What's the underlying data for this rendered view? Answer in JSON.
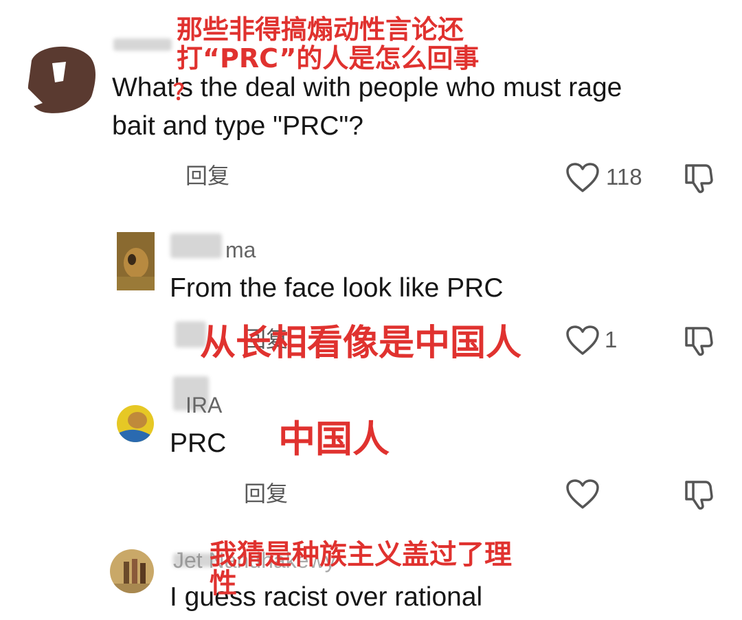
{
  "comments": [
    {
      "username": "",
      "text_lines": [
        "What's the deal with people who must rage",
        "bait and type \"PRC\"?"
      ],
      "reply_label": "回复",
      "likes": "118",
      "annotation_lines": [
        "那些非得搞煽动性言论还",
        "打“PRC”的人是怎么回事"
      ],
      "annotation_mark": "？"
    },
    {
      "username": "ma",
      "text": "From the face look like PRC",
      "reply_label": "回复",
      "likes": "1",
      "annotation": "从长相看像是中国人"
    },
    {
      "username": "IRA",
      "text": "PRC",
      "reply_label": "回复",
      "likes": "",
      "annotation": "中国人"
    },
    {
      "username": "Jet Nandhakewy",
      "text": "I guess racist over rational",
      "annotation_lines": [
        "我猜是种族主义盖过了理",
        "性"
      ]
    }
  ],
  "icons": {
    "like": "heart-outline-icon",
    "dislike": "thumbs-down-outline-icon"
  },
  "colors": {
    "annotation": "#e0322f",
    "text": "#161616",
    "secondary": "#5a5a5a"
  }
}
